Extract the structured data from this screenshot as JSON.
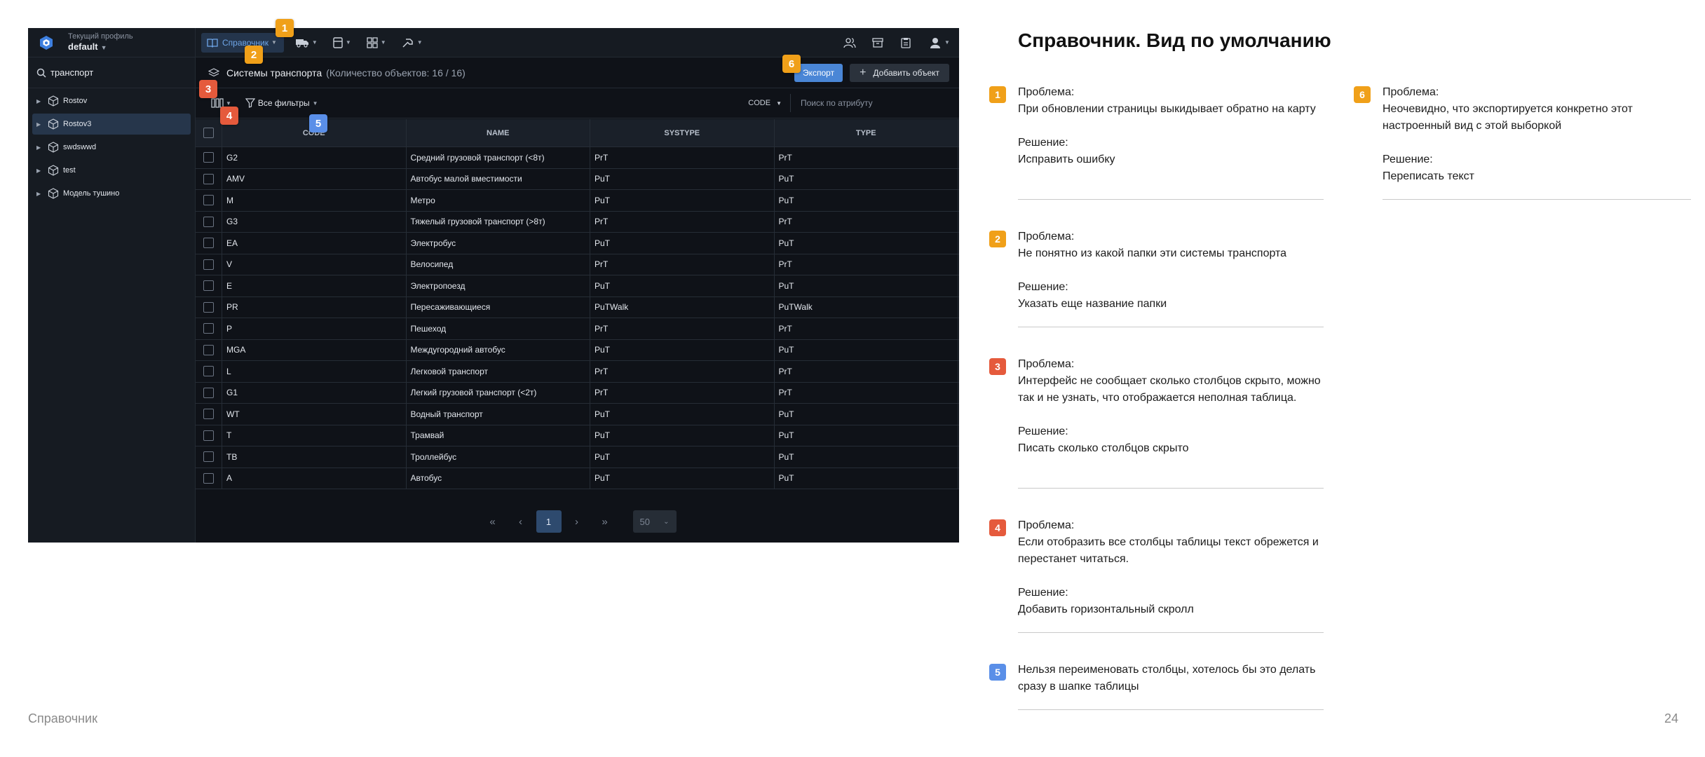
{
  "app": {
    "profile": {
      "caption": "Текущий профиль",
      "name": "default"
    },
    "search": {
      "value": "транспорт"
    },
    "tree": [
      {
        "label": "Rostov",
        "selected": false
      },
      {
        "label": "Rostov3",
        "selected": true
      },
      {
        "label": "swdswwd",
        "selected": false
      },
      {
        "label": "test",
        "selected": false
      },
      {
        "label": "Модель тушино",
        "selected": false
      }
    ],
    "toolbar": {
      "reference_label": "Справочник"
    },
    "header": {
      "title": "Системы транспорта",
      "count": "(Количество объектов: 16 / 16)",
      "export_label": "Экспорт",
      "add_label": "Добавить объект"
    },
    "filters": {
      "all_filters_label": "Все фильтры",
      "attribute": "CODE",
      "attribute_search_placeholder": "Поиск по атрибуту"
    },
    "table": {
      "columns": [
        "CODE",
        "NAME",
        "SYSTYPE",
        "TYPE"
      ],
      "rows": [
        [
          "G2",
          "Средний грузовой транспорт (<8т)",
          "PrT",
          "PrT"
        ],
        [
          "AMV",
          "Автобус малой вместимости",
          "PuT",
          "PuT"
        ],
        [
          "M",
          "Метро",
          "PuT",
          "PuT"
        ],
        [
          "G3",
          "Тяжелый грузовой транспорт (>8т)",
          "PrT",
          "PrT"
        ],
        [
          "EA",
          "Электробус",
          "PuT",
          "PuT"
        ],
        [
          "V",
          "Велосипед",
          "PrT",
          "PrT"
        ],
        [
          "E",
          "Электропоезд",
          "PuT",
          "PuT"
        ],
        [
          "PR",
          "Пересаживающиеся",
          "PuTWalk",
          "PuTWalk"
        ],
        [
          "P",
          "Пешеход",
          "PrT",
          "PrT"
        ],
        [
          "MGA",
          "Междугородний автобус",
          "PuT",
          "PuT"
        ],
        [
          "L",
          "Легковой транспорт",
          "PrT",
          "PrT"
        ],
        [
          "G1",
          "Легкий грузовой транспорт (<2т)",
          "PrT",
          "PrT"
        ],
        [
          "WT",
          "Водный транспорт",
          "PuT",
          "PuT"
        ],
        [
          "T",
          "Трамвай",
          "PuT",
          "PuT"
        ],
        [
          "TB",
          "Троллейбус",
          "PuT",
          "PuT"
        ],
        [
          "A",
          "Автобус",
          "PuT",
          "PuT"
        ]
      ]
    },
    "pagination": {
      "current_page": "1",
      "page_size": "50"
    }
  },
  "markers": [
    "1",
    "2",
    "3",
    "4",
    "5",
    "6"
  ],
  "colors": {
    "orange": "#f0a019",
    "red": "#e55a3c",
    "blue": "#5a8fe8"
  },
  "slide": {
    "title": "Справочник. Вид по умолчанию",
    "footer_left": "Справочник",
    "page_number": "24"
  },
  "notes": [
    {
      "number": "1",
      "color": "orange",
      "problem_label": "Проблема:",
      "problem": "При обновлении страницы выкидывает обратно на карту",
      "solution_label": "Решение:",
      "solution": "Исправить ошибку"
    },
    {
      "number": "2",
      "color": "orange",
      "problem_label": "Проблема:",
      "problem": "Не понятно из какой папки эти системы транспорта",
      "solution_label": "Решение:",
      "solution": "Указать еще название папки"
    },
    {
      "number": "3",
      "color": "red",
      "problem_label": "Проблема:",
      "problem": "Интерфейс не сообщает сколько столбцов скрыто, можно так и не узнать, что отображается неполная таблица.",
      "solution_label": "Решение:",
      "solution": "Писать сколько столбцов скрыто"
    },
    {
      "number": "4",
      "color": "red",
      "problem_label": "Проблема:",
      "problem": "Если отобразить все столбцы таблицы текст обрежется и перестанет читаться.",
      "solution_label": "Решение:",
      "solution": "Добавить горизонтальный скролл"
    },
    {
      "number": "5",
      "color": "blue",
      "text": "Нельзя переименовать столбцы, хотелось бы это делать сразу в шапке таблицы"
    },
    {
      "number": "6",
      "color": "orange",
      "problem_label": "Проблема:",
      "problem": "Неочевидно, что экспортируется конкретно этот настроенный вид с этой выборкой",
      "solution_label": "Решение:",
      "solution": "Переписать текст"
    }
  ]
}
